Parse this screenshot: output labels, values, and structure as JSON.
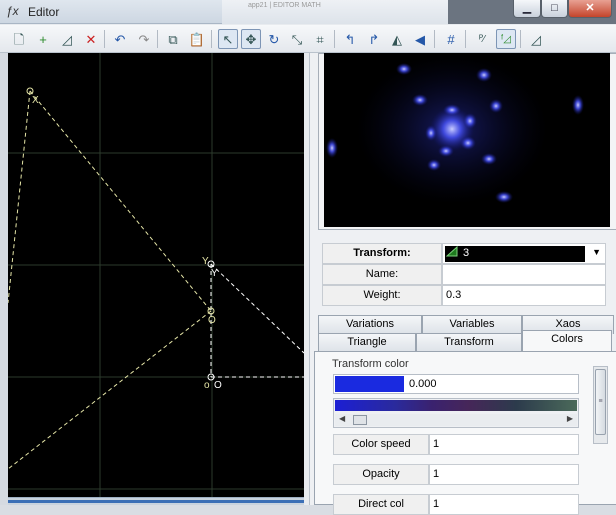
{
  "window": {
    "title": "Editor",
    "icon": "fx-icon",
    "background_title_text": "app21 | EDITOR MATH",
    "controls": [
      "minimize",
      "maximize",
      "close"
    ]
  },
  "toolbar": {
    "items": [
      "new-icon",
      "add-icon",
      "duplicate-icon",
      "delete-icon",
      "undo-icon",
      "redo-icon",
      "copy-icon",
      "paste-icon",
      "select-icon",
      "move-icon",
      "rotate-icon",
      "scale-icon",
      "fit-icon",
      "undo-arrow-icon",
      "redo-arrow-icon",
      "flip-horizontal-icon",
      "flip-vertical-icon",
      "grid-icon",
      "post-transform-icon",
      "final-transform-icon",
      "reset-icon"
    ],
    "active": [
      "select-icon",
      "move-icon",
      "final-transform-icon"
    ]
  },
  "triangle_canvas": {
    "vertex_labels": [
      "X",
      "Y",
      "O",
      "Y",
      "O"
    ]
  },
  "properties": {
    "transform_label": "Transform:",
    "transform_value": "3",
    "name_label": "Name:",
    "name_value": "",
    "weight_label": "Weight:",
    "weight_value": "0.3"
  },
  "tabs": {
    "row1": [
      "Variations",
      "Variables",
      "Xaos"
    ],
    "row2": [
      "Triangle",
      "Transform",
      "Colors"
    ],
    "active": "Colors"
  },
  "colors_panel": {
    "group_label": "Transform color",
    "color_value": "0.000",
    "swatch_color": "#1a2ae0",
    "color_speed_label": "Color speed",
    "color_speed_value": "1",
    "opacity_label": "Opacity",
    "opacity_value": "1",
    "partial_label": "Direct col",
    "partial_value": "1"
  }
}
